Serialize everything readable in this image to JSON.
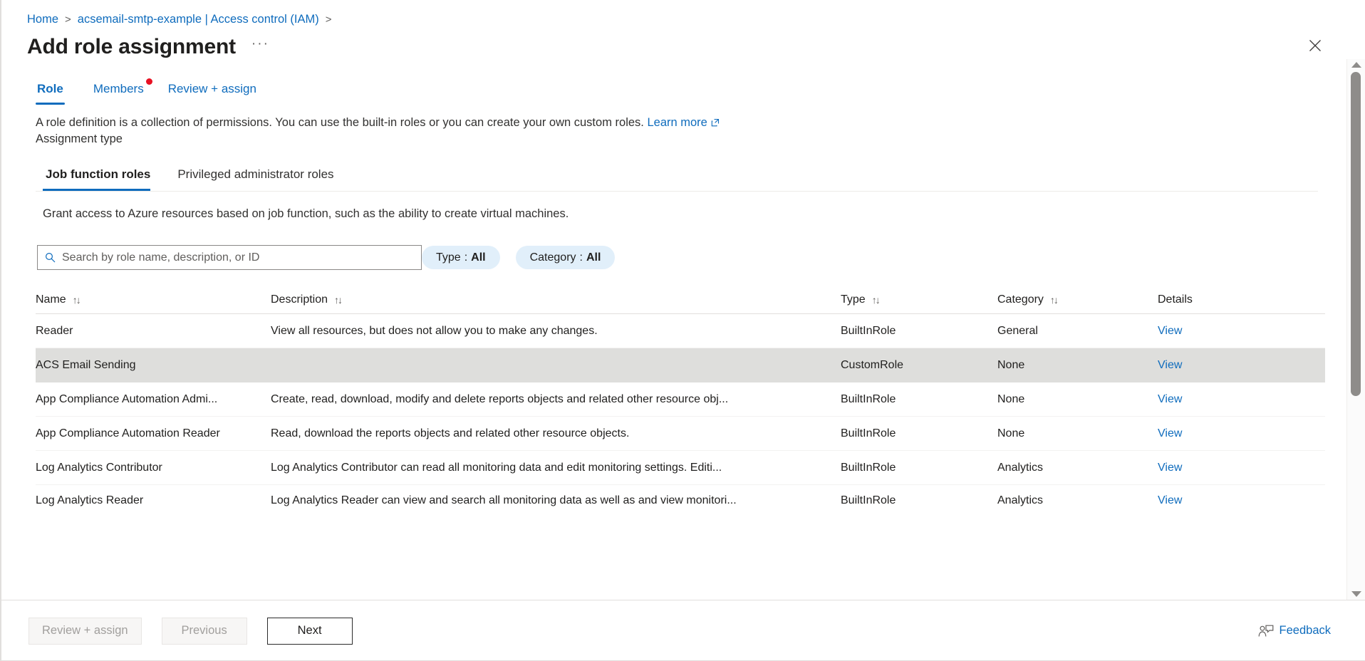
{
  "breadcrumb": {
    "items": [
      {
        "label": "Home"
      },
      {
        "label": "acsemail-smtp-example | Access control (IAM)"
      }
    ],
    "separator": ">"
  },
  "header": {
    "title": "Add role assignment",
    "ellipsis": "···",
    "close_icon": "close-icon"
  },
  "tabs": [
    {
      "label": "Role",
      "selected": true,
      "badge": false
    },
    {
      "label": "Members",
      "selected": false,
      "badge": true
    },
    {
      "label": "Review + assign",
      "selected": false,
      "badge": false
    }
  ],
  "intro": {
    "text": "A role definition is a collection of permissions. You can use the built-in roles or you can create your own custom roles.",
    "learn_more": "Learn more",
    "assignment_type_label": "Assignment type"
  },
  "subtabs": [
    {
      "label": "Job function roles",
      "selected": true
    },
    {
      "label": "Privileged administrator roles",
      "selected": false
    }
  ],
  "grant_text": "Grant access to Azure resources based on job function, such as the ability to create virtual machines.",
  "search": {
    "placeholder": "Search by role name, description, or ID",
    "value": "",
    "icon": "search-icon"
  },
  "filters": [
    {
      "name": "Type",
      "separator": ":",
      "value": "All"
    },
    {
      "name": "Category",
      "separator": ":",
      "value": "All"
    }
  ],
  "table": {
    "columns": [
      {
        "label": "Name",
        "sortable": true
      },
      {
        "label": "Description",
        "sortable": true
      },
      {
        "label": "Type",
        "sortable": true
      },
      {
        "label": "Category",
        "sortable": true
      },
      {
        "label": "Details",
        "sortable": false
      }
    ],
    "sort_icon": "↑↓",
    "details_link_label": "View",
    "rows": [
      {
        "name": "Reader",
        "description": "View all resources, but does not allow you to make any changes.",
        "type": "BuiltInRole",
        "category": "General",
        "details": "View",
        "selected": false
      },
      {
        "name": "ACS Email Sending",
        "description": "",
        "type": "CustomRole",
        "category": "None",
        "details": "View",
        "selected": true
      },
      {
        "name": "App Compliance Automation Admi...",
        "description": "Create, read, download, modify and delete reports objects and related other resource obj...",
        "type": "BuiltInRole",
        "category": "None",
        "details": "View",
        "selected": false
      },
      {
        "name": "App Compliance Automation Reader",
        "description": "Read, download the reports objects and related other resource objects.",
        "type": "BuiltInRole",
        "category": "None",
        "details": "View",
        "selected": false
      },
      {
        "name": "Log Analytics Contributor",
        "description": "Log Analytics Contributor can read all monitoring data and edit monitoring settings. Editi...",
        "type": "BuiltInRole",
        "category": "Analytics",
        "details": "View",
        "selected": false
      },
      {
        "name": "Log Analytics Reader",
        "description": "Log Analytics Reader can view and search all monitoring data as well as and view monitori...",
        "type": "BuiltInRole",
        "category": "Analytics",
        "details": "View",
        "selected": false
      }
    ]
  },
  "footer": {
    "review_assign": "Review + assign",
    "previous": "Previous",
    "next": "Next",
    "feedback": "Feedback"
  },
  "colors": {
    "accent": "#0f6cbd",
    "badge": "#e81123",
    "selected_row": "#dededc",
    "pill_bg": "#e1effa"
  }
}
